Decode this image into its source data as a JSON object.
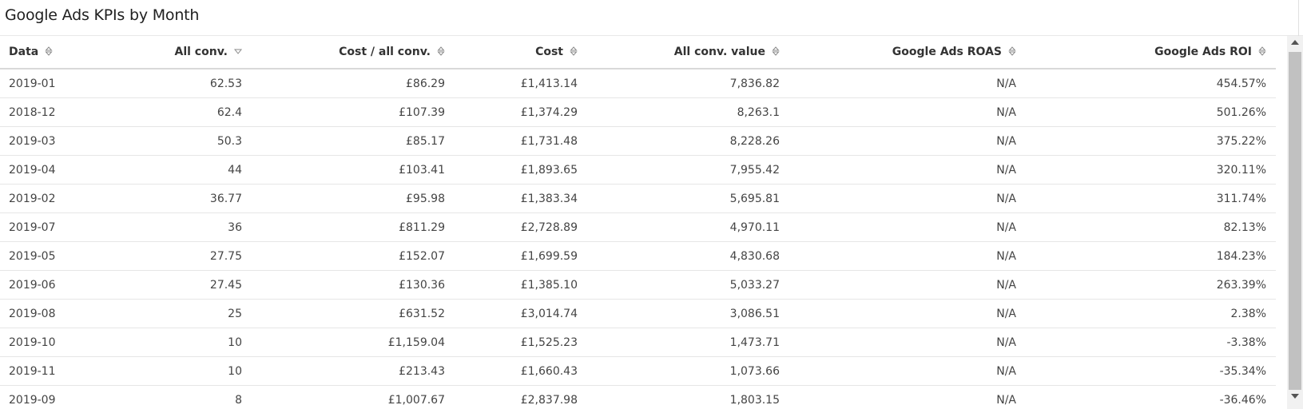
{
  "title": "Google Ads KPIs by Month",
  "table": {
    "columns": [
      {
        "label": "Data",
        "sort": "none"
      },
      {
        "label": "All conv.",
        "sort": "desc"
      },
      {
        "label": "Cost / all conv.",
        "sort": "none"
      },
      {
        "label": "Cost",
        "sort": "none"
      },
      {
        "label": "All conv. value",
        "sort": "none"
      },
      {
        "label": "Google Ads ROAS",
        "sort": "none"
      },
      {
        "label": "Google Ads ROI",
        "sort": "none"
      }
    ],
    "rows": [
      [
        "2019-01",
        "62.53",
        "£86.29",
        "£1,413.14",
        "7,836.82",
        "N/A",
        "454.57%"
      ],
      [
        "2018-12",
        "62.4",
        "£107.39",
        "£1,374.29",
        "8,263.1",
        "N/A",
        "501.26%"
      ],
      [
        "2019-03",
        "50.3",
        "£85.17",
        "£1,731.48",
        "8,228.26",
        "N/A",
        "375.22%"
      ],
      [
        "2019-04",
        "44",
        "£103.41",
        "£1,893.65",
        "7,955.42",
        "N/A",
        "320.11%"
      ],
      [
        "2019-02",
        "36.77",
        "£95.98",
        "£1,383.34",
        "5,695.81",
        "N/A",
        "311.74%"
      ],
      [
        "2019-07",
        "36",
        "£811.29",
        "£2,728.89",
        "4,970.11",
        "N/A",
        "82.13%"
      ],
      [
        "2019-05",
        "27.75",
        "£152.07",
        "£1,699.59",
        "4,830.68",
        "N/A",
        "184.23%"
      ],
      [
        "2019-06",
        "27.45",
        "£130.36",
        "£1,385.10",
        "5,033.27",
        "N/A",
        "263.39%"
      ],
      [
        "2019-08",
        "25",
        "£631.52",
        "£3,014.74",
        "3,086.51",
        "N/A",
        "2.38%"
      ],
      [
        "2019-10",
        "10",
        "£1,159.04",
        "£1,525.23",
        "1,473.71",
        "N/A",
        "-3.38%"
      ],
      [
        "2019-11",
        "10",
        "£213.43",
        "£1,660.43",
        "1,073.66",
        "N/A",
        "-35.34%"
      ],
      [
        "2019-09",
        "8",
        "£1,007.67",
        "£2,837.98",
        "1,803.15",
        "N/A",
        "-36.46%"
      ]
    ]
  },
  "scrollbar": {
    "position": 0
  }
}
